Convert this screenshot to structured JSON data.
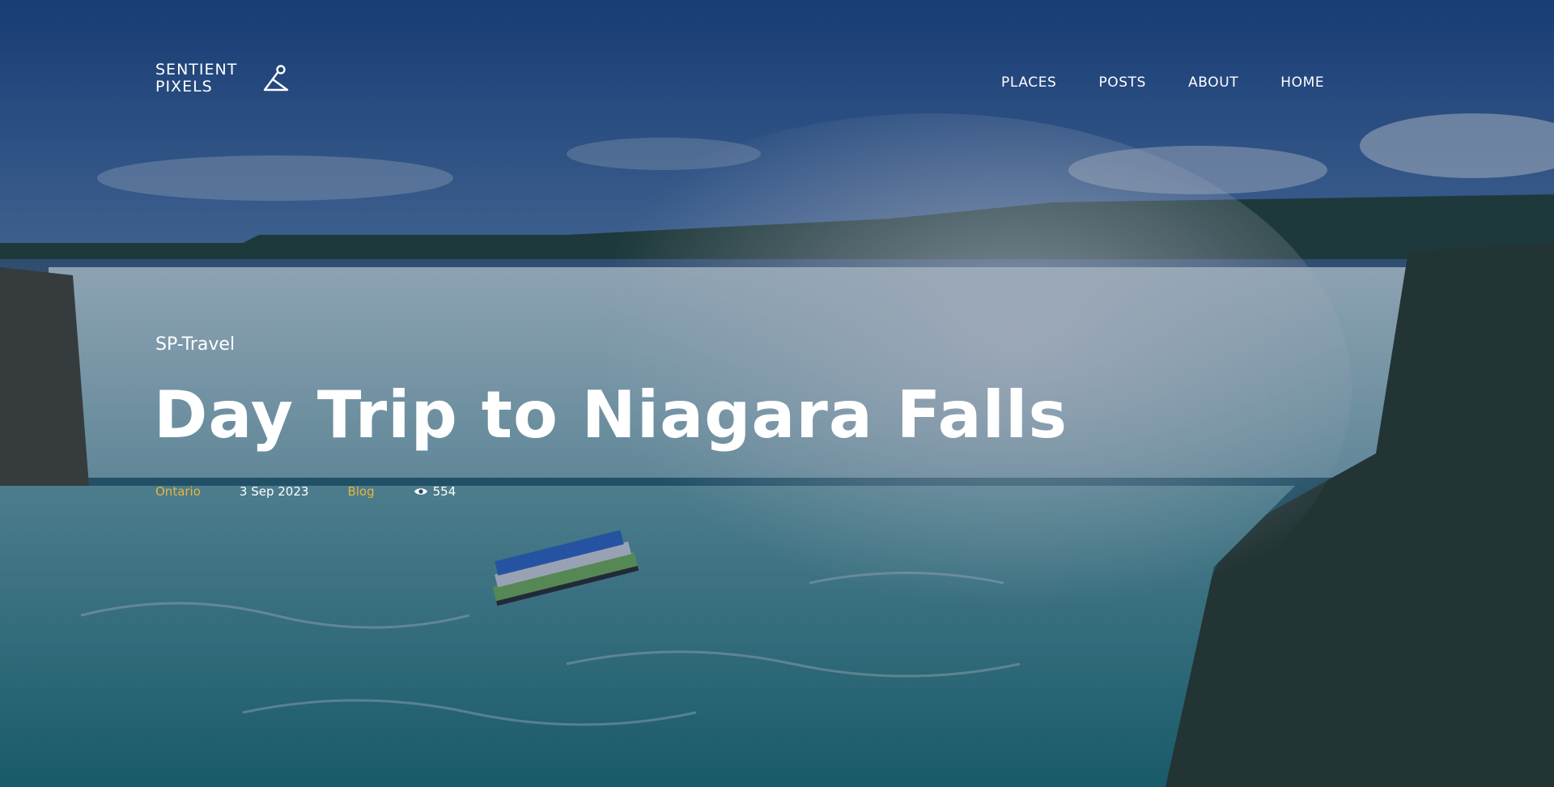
{
  "brand": {
    "line1": "SENTIENT",
    "line2": "PIXELS",
    "logo_icon": "hanger-logo-icon"
  },
  "nav": {
    "items": [
      {
        "label": "PLACES"
      },
      {
        "label": "POSTS"
      },
      {
        "label": "ABOUT"
      },
      {
        "label": "HOME"
      }
    ]
  },
  "article": {
    "category": "SP-Travel",
    "title": "Day Trip to Niagara Falls",
    "location": "Ontario",
    "date": "3 Sep 2023",
    "section": "Blog",
    "views": "554",
    "views_icon": "eye-icon"
  },
  "colors": {
    "accent": "#e7b43d",
    "text": "#ffffff"
  }
}
